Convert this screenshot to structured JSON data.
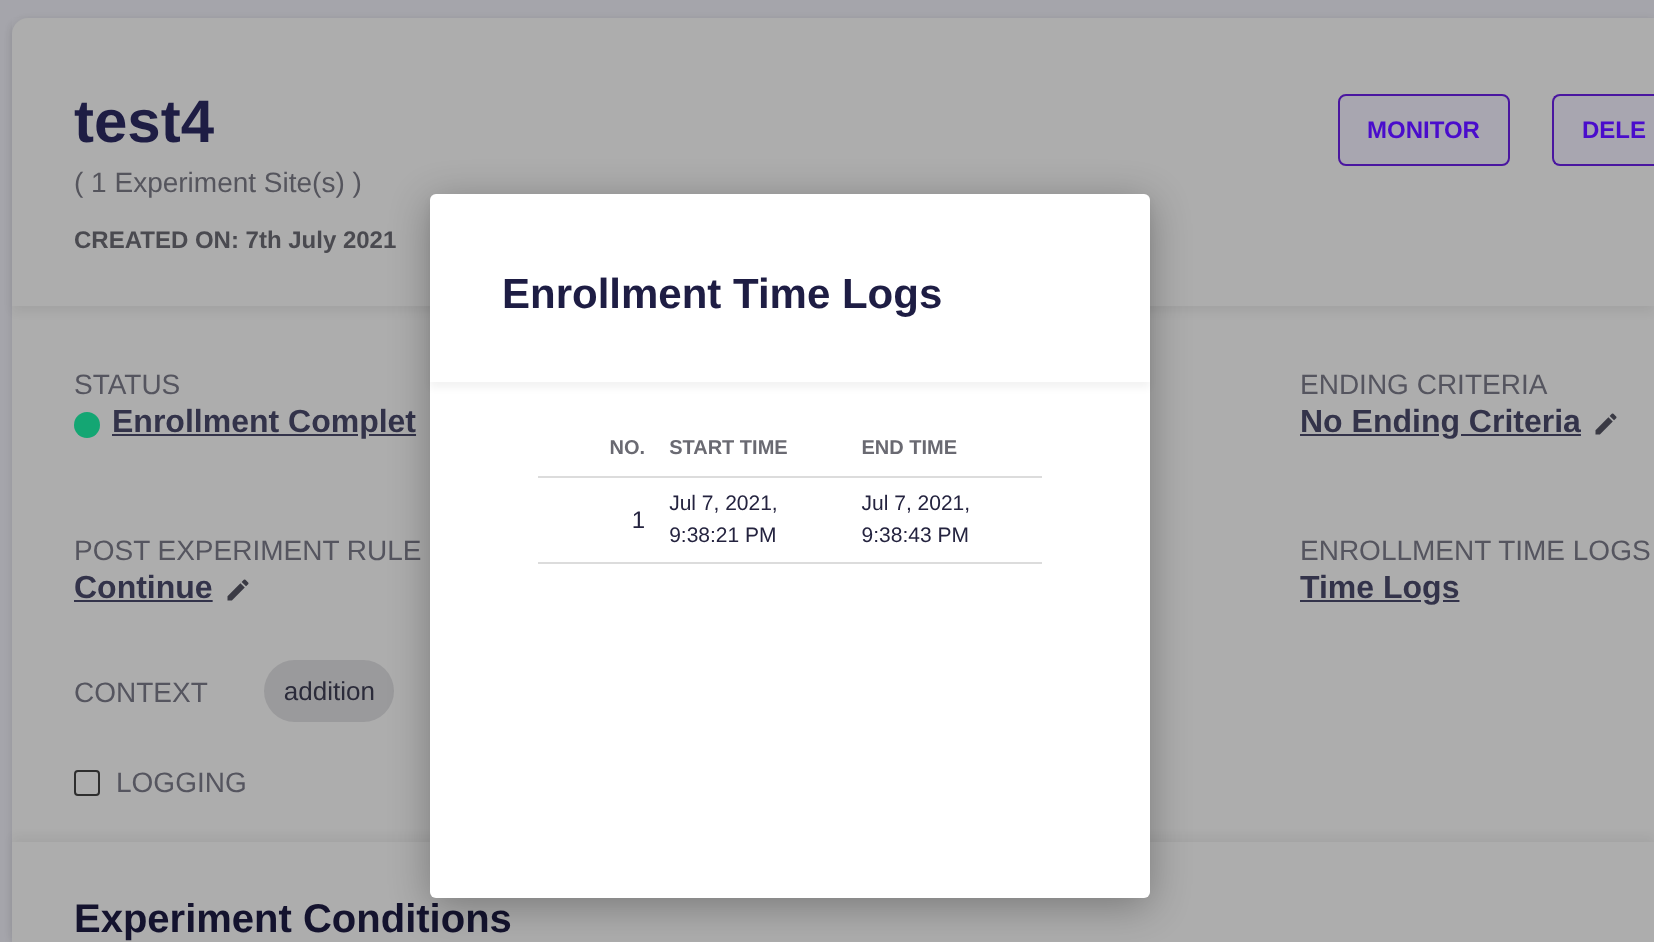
{
  "experiment": {
    "name": "test4",
    "sites": "( 1 Experiment Site(s) )",
    "created_on": "CREATED ON: 7th July 2021",
    "actions": [
      "MONITOR",
      "DELE"
    ],
    "status": {
      "label": "STATUS",
      "value": "Enrollment Complet",
      "color": "#14a673"
    },
    "ending_criteria": {
      "label": "ENDING CRITERIA",
      "value": "No Ending Criteria"
    },
    "post_experiment_rule": {
      "label": "POST EXPERIMENT RULE",
      "value": "Continue"
    },
    "enrollment_time_logs": {
      "label": "ENROLLMENT TIME LOGS",
      "value": "Time Logs"
    },
    "context": {
      "label": "CONTEXT",
      "tags": [
        "addition"
      ]
    },
    "logging": {
      "label": "LOGGING",
      "checked": false
    },
    "section_title": "Experiment Conditions"
  },
  "modal": {
    "title": "Enrollment Time Logs",
    "columns": [
      "NO.",
      "START TIME",
      "END TIME"
    ],
    "rows": [
      {
        "no": "1",
        "start_time": "Jul 7, 2021, 9:38:21 PM",
        "end_time": "Jul 7, 2021, 9:38:43 PM"
      }
    ]
  }
}
